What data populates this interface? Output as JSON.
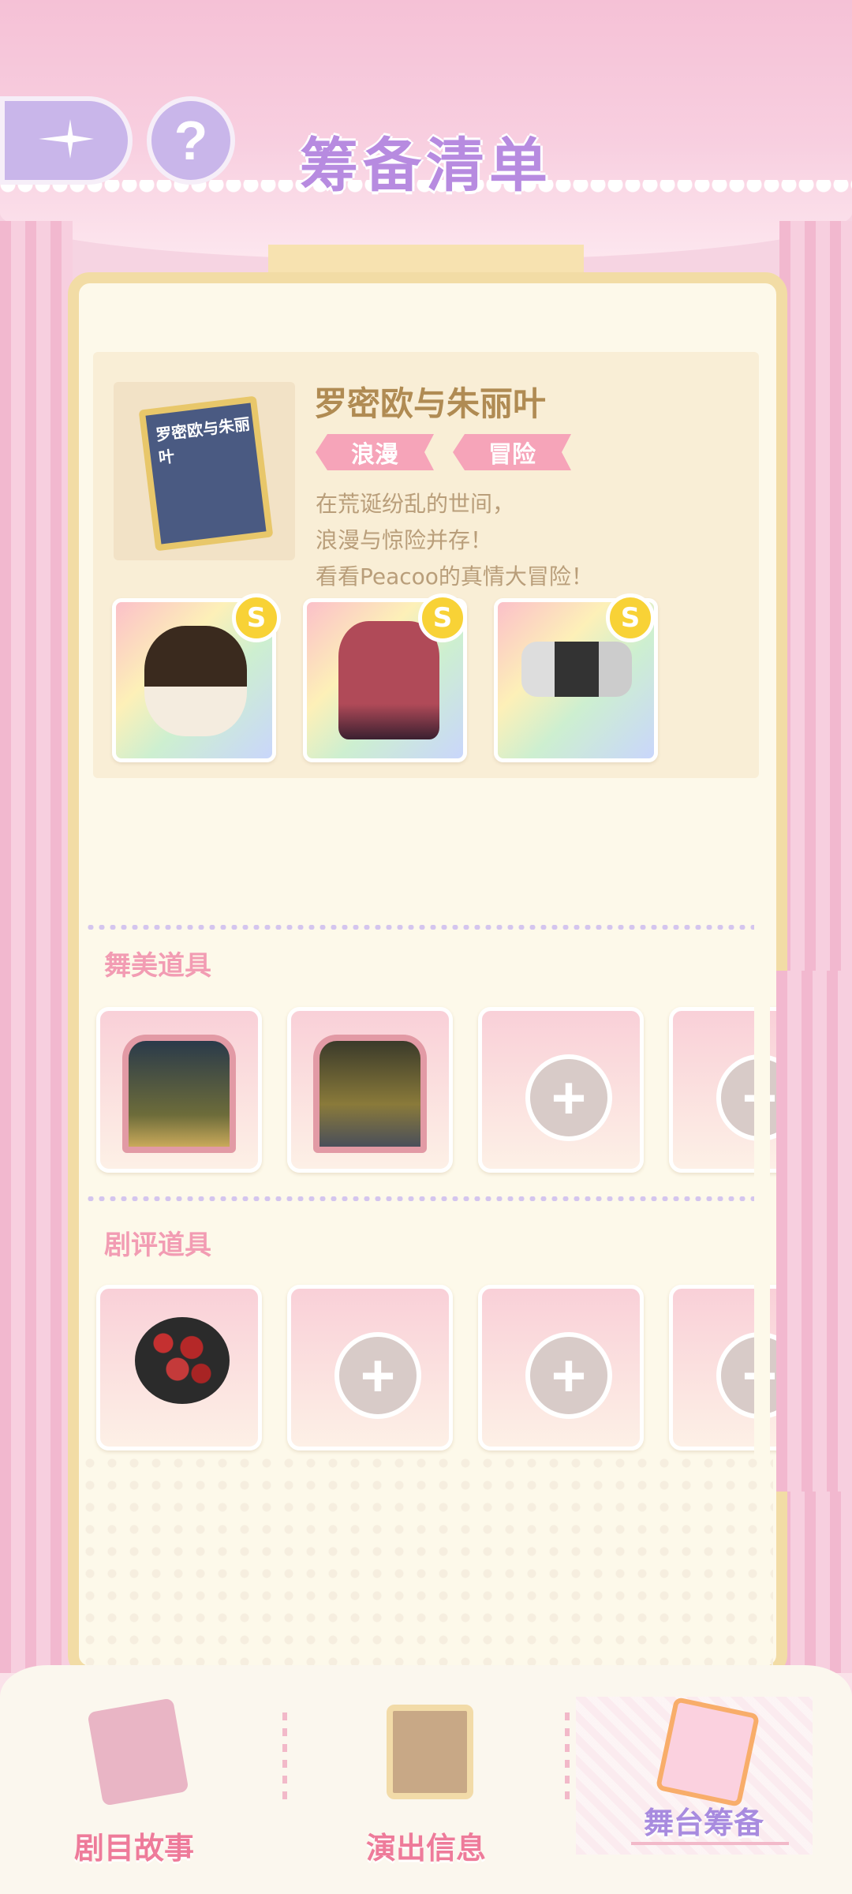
{
  "header": {
    "title": "筹备清单",
    "back_icon": "star-back-icon",
    "help_label": "?"
  },
  "story": {
    "title": "罗密欧与朱丽叶",
    "cover_text": "罗密欧与朱丽叶",
    "tags": [
      "浪漫",
      "冒险"
    ],
    "description": [
      "在荒诞纷乱的世间，",
      "浪漫与惊险并存！",
      "看看Peacoo的真情大冒险！"
    ],
    "items": [
      {
        "name": "corset-outfit",
        "badge": "S"
      },
      {
        "name": "red-dress",
        "badge": "S"
      },
      {
        "name": "gauze-accessory",
        "badge": "S"
      }
    ]
  },
  "sections": {
    "stage_props": {
      "label": "舞美道具",
      "slots": [
        "garden-stage",
        "night-stage",
        "+",
        "+"
      ]
    },
    "review_props": {
      "label": "剧评道具",
      "slots": [
        "rose-bouquet",
        "+",
        "+",
        "+"
      ]
    }
  },
  "bottom_nav": [
    {
      "label": "剧目故事",
      "icon": "storybook-icon"
    },
    {
      "label": "演出信息",
      "icon": "info-board-icon"
    },
    {
      "label": "舞台筹备",
      "icon": "clipboard-icon",
      "active": true
    }
  ],
  "colors": {
    "title": "#b78be0",
    "tag_bg": "#f6a4b9",
    "section_label": "#f29cb3",
    "nav_label": "#ee7b9a",
    "nav_active": "#a88bdf"
  }
}
